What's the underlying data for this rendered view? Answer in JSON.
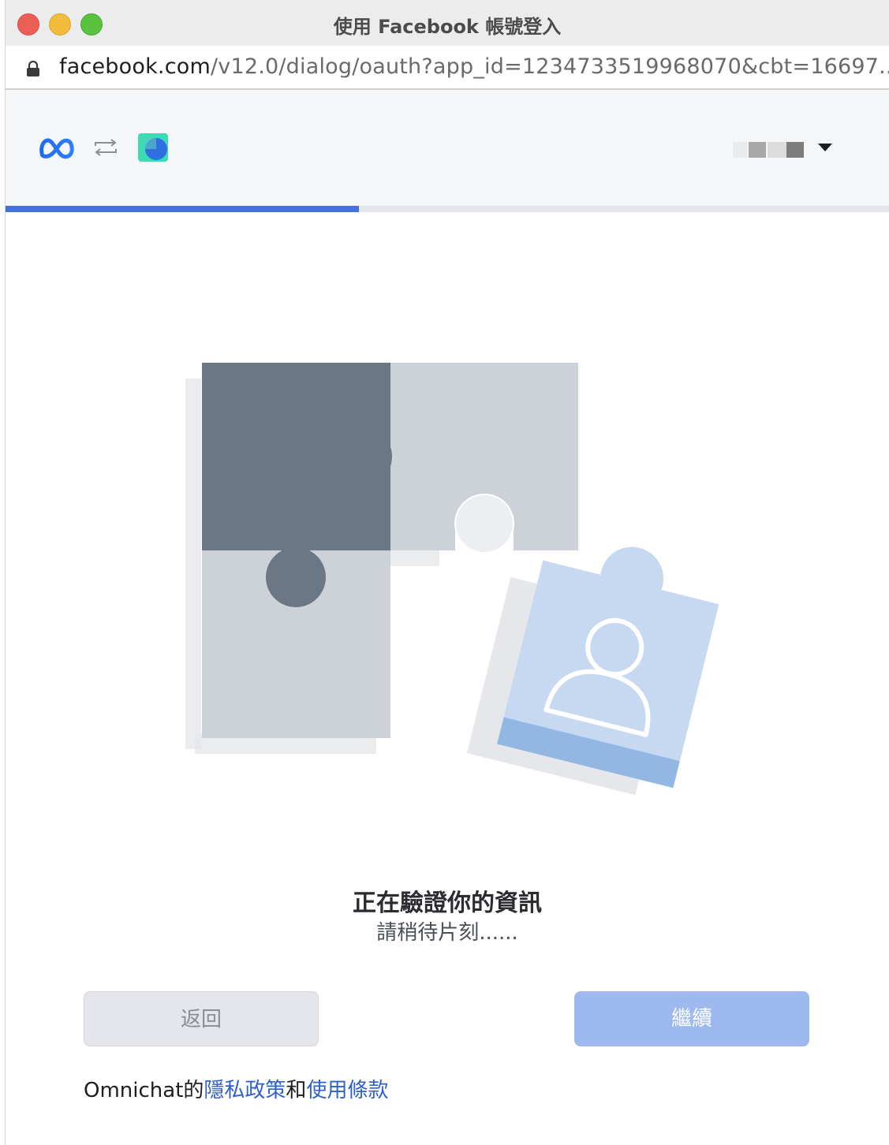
{
  "window": {
    "title": "使用 Facebook 帳號登入",
    "traffic_lights": [
      "close",
      "minimize",
      "zoom"
    ]
  },
  "address_bar": {
    "lock_icon": "lock-icon",
    "url_domain": "facebook.com",
    "url_path": "/v12.0/dialog/oauth?app_id=1234733519968070&cbt=16697..."
  },
  "header": {
    "meta_logo": "meta-logo-icon",
    "sync_icon": "sync-arrows-icon",
    "app_logo": "omnichat-logo-icon",
    "account_dropdown_icon": "caret-down-icon"
  },
  "progress": {
    "value": 0.4
  },
  "illustration": {
    "name": "puzzle-profile-illustration"
  },
  "status": {
    "title": "正在驗證你的資訊",
    "subtitle": "請稍待片刻......"
  },
  "buttons": {
    "back_label": "返回",
    "continue_label": "繼續"
  },
  "footer": {
    "prefix": "Omnichat的",
    "privacy_link": "隱私政策",
    "conjunction": "和",
    "terms_link": "使用條款"
  },
  "colors": {
    "accent_blue": "#4472D8",
    "link_blue": "#2F61CC",
    "continue_disabled": "#9DB9EF",
    "back_disabled": "#E4E6EB",
    "dark_piece": "#6B7785",
    "light_piece": "#CDD2D9",
    "profile_piece": "#C6D9F1"
  }
}
